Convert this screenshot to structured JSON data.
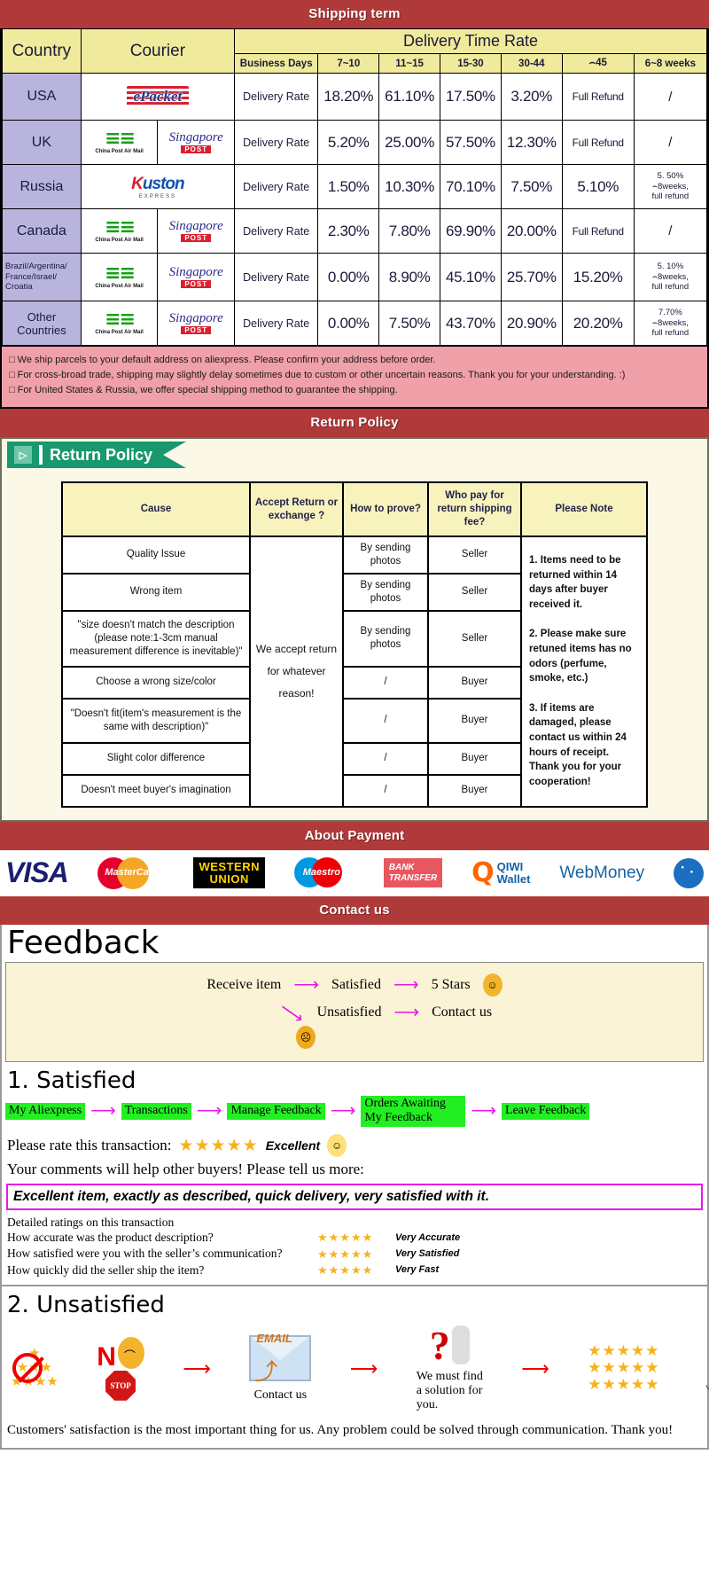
{
  "banners": {
    "shipping": "Shipping term",
    "return": "Return Policy",
    "payment": "About Payment",
    "contact": "Contact us"
  },
  "shipping_table": {
    "col_country": "Country",
    "col_courier": "Courier",
    "col_dtr": "Delivery Time Rate",
    "sub_headers": [
      "Business Days",
      "7~10",
      "11~15",
      "15-30",
      "30-44",
      "⌢45",
      "6~8 weeks"
    ],
    "rows": [
      {
        "country": "USA",
        "couriers": [
          "epacket"
        ],
        "rate_label": "Delivery Rate",
        "values": [
          "18.20%",
          "61.10%",
          "17.50%",
          "3.20%",
          "Full Refund",
          "/"
        ]
      },
      {
        "country": "UK",
        "couriers": [
          "china-post-air-mail",
          "singapore-post"
        ],
        "rate_label": "Delivery Rate",
        "values": [
          "5.20%",
          "25.00%",
          "57.50%",
          "12.30%",
          "Full Refund",
          "/"
        ]
      },
      {
        "country": "Russia",
        "couriers": [
          "kuston-express"
        ],
        "rate_label": "Delivery Rate",
        "values": [
          "1.50%",
          "10.30%",
          "70.10%",
          "7.50%",
          "5.10%",
          "5. 50%\n⌢8weeks,\nfull refund"
        ]
      },
      {
        "country": "Canada",
        "couriers": [
          "china-post-air-mail",
          "singapore-post"
        ],
        "rate_label": "Delivery Rate",
        "values": [
          "2.30%",
          "7.80%",
          "69.90%",
          "20.00%",
          "Full Refund",
          "/"
        ]
      },
      {
        "country": "Brazil/Argentina/\nFrance/Israel/\nCroatia",
        "couriers": [
          "china-post-air-mail",
          "singapore-post"
        ],
        "rate_label": "Delivery Rate",
        "values": [
          "0.00%",
          "8.90%",
          "45.10%",
          "25.70%",
          "15.20%",
          "5. 10%\n⌢8weeks,\nfull refund"
        ]
      },
      {
        "country": "Other Countries",
        "couriers": [
          "china-post-air-mail",
          "singapore-post"
        ],
        "rate_label": "Delivery Rate",
        "values": [
          "0.00%",
          "7.50%",
          "43.70%",
          "20.90%",
          "20.20%",
          "7.70%\n⌢8weeks,\nfull refund"
        ]
      }
    ],
    "notes": [
      "We ship parcels to your default address on aliexpress. Please confirm your address before order.",
      "For cross-broad trade, shipping may slightly delay sometimes due to custom or other uncertain reasons. Thank you for your understanding. :)",
      "For United States & Russia, we offer special shipping method to guarantee the shipping."
    ]
  },
  "return_policy": {
    "tag_label": "Return Policy",
    "headers": [
      "Cause",
      "Accept Return or exchange ?",
      "How to prove?",
      "Who pay for return shipping fee?",
      "Please Note"
    ],
    "accept_text": "We accept return for whatever reason!",
    "rows": [
      {
        "cause": "Quality Issue",
        "prove": "By sending photos",
        "who_pays": "Seller"
      },
      {
        "cause": "Wrong item",
        "prove": "By sending photos",
        "who_pays": "Seller"
      },
      {
        "cause": "\"size doesn't match the description (please note:1-3cm manual measurement difference is inevitable)\"",
        "prove": "By sending photos",
        "who_pays": "Seller"
      },
      {
        "cause": "Choose a wrong size/color",
        "prove": "/",
        "who_pays": "Buyer"
      },
      {
        "cause": "\"Doesn't fit(item's measurement is the same with description)\"",
        "prove": "/",
        "who_pays": "Buyer"
      },
      {
        "cause": "Slight color difference",
        "prove": "/",
        "who_pays": "Buyer"
      },
      {
        "cause": "Doesn't meet buyer's imagination",
        "prove": "/",
        "who_pays": "Buyer"
      }
    ],
    "note": "1. Items need to be returned within 14 days after buyer received it.\n\n2. Please make sure retuned items has no odors (perfume, smoke, etc.)\n\n3. If items are damaged, please contact us within 24 hours of receipt.\nThank you for your cooperation!"
  },
  "payment_methods": [
    {
      "name": "visa",
      "label": "VISA"
    },
    {
      "name": "mastercard",
      "label": "MasterCard"
    },
    {
      "name": "western-union",
      "label_1": "WESTERN",
      "label_2": "UNION"
    },
    {
      "name": "maestro",
      "label": "Maestro"
    },
    {
      "name": "bank-transfer",
      "label_1": "BANK",
      "label_2": "TRANSFER"
    },
    {
      "name": "qiwi-wallet",
      "label_1": "QIWI",
      "label_2": "Wallet"
    },
    {
      "name": "webmoney",
      "label": "WebMoney"
    },
    {
      "name": "globe",
      "label": ""
    }
  ],
  "feedback": {
    "title": "Feedback",
    "flow": {
      "receive": "Receive item",
      "satisfied": "Satisfied",
      "five_stars": "5 Stars",
      "unsatisfied": "Unsatisfied",
      "contact": "Contact us"
    },
    "satisfied": {
      "heading": "1. Satisfied",
      "steps": [
        "My Aliexpress",
        "Transactions",
        "Manage Feedback",
        "Orders Awaiting My Feedback",
        "Leave Feedback"
      ],
      "rate_prompt": "Please rate this transaction:",
      "stars": "★★★★★",
      "rate_word": "Excellent",
      "comments_prompt": "Your comments will help other buyers! Please tell us more:",
      "comment_text": "Excellent item, exactly as described, quick delivery, very satisfied with it.",
      "detailed_heading": "Detailed ratings on this transaction",
      "detailed": [
        {
          "question": "How accurate was the product description?",
          "stars": "★★★★★",
          "label": "Very Accurate"
        },
        {
          "question": "How satisfied were you with the seller’s communication?",
          "stars": "★★★★★",
          "label": "Very Satisfied"
        },
        {
          "question": "How quickly did the seller ship the item?",
          "stars": "★★★★★",
          "label": "Very Fast"
        }
      ]
    },
    "unsatisfied": {
      "heading": "2. Unsatisfied",
      "no_label": "N",
      "stop_label": "STOP",
      "email_label": "EMAIL",
      "contact_caption": "Contact us",
      "solution_caption": "We must find\na solution for\nyou.",
      "footer": "Customers' satisfaction is the most important thing for us. Any problem could be solved through communication. Thank you!"
    }
  }
}
